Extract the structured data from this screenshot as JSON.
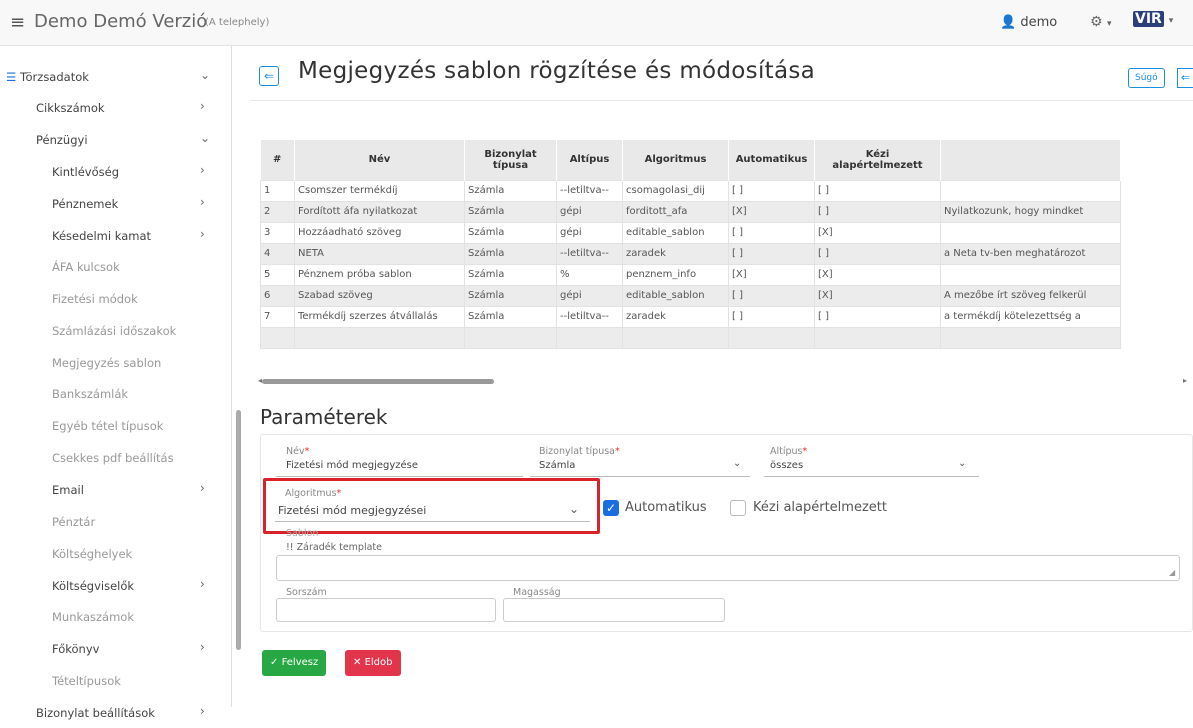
{
  "header": {
    "menu_icon": "menu-icon",
    "app_title": "Demo Demó Verzió",
    "app_sub": "(A telephely)",
    "user_icon": "user-icon",
    "user_name": "demo",
    "settings_icon": "gear-icon",
    "logo_text": "VIR"
  },
  "sidebar": {
    "items": [
      {
        "label": "Törzsadatok",
        "chevron": "⌄"
      },
      {
        "label": "Cikkszámok",
        "chevron": "›"
      },
      {
        "label": "Pénzügyi",
        "chevron": "⌄"
      },
      {
        "label": "Kintlévőség",
        "chevron": "›"
      },
      {
        "label": "Pénznemek",
        "chevron": "›"
      },
      {
        "label": "Késedelmi kamat",
        "chevron": "›"
      },
      {
        "label": "ÁFA kulcsok",
        "chevron": ""
      },
      {
        "label": "Fizetési módok",
        "chevron": ""
      },
      {
        "label": "Számlázási időszakok",
        "chevron": ""
      },
      {
        "label": "Megjegyzés sablon",
        "chevron": ""
      },
      {
        "label": "Bankszámlák",
        "chevron": ""
      },
      {
        "label": "Egyéb tétel típusok",
        "chevron": ""
      },
      {
        "label": "Csekkes pdf beállítás",
        "chevron": ""
      },
      {
        "label": "Email",
        "chevron": "›"
      },
      {
        "label": "Pénztár",
        "chevron": ""
      },
      {
        "label": "Költséghelyek",
        "chevron": ""
      },
      {
        "label": "Költségviselők",
        "chevron": "›"
      },
      {
        "label": "Munkaszámok",
        "chevron": ""
      },
      {
        "label": "Főkönyv",
        "chevron": "›"
      },
      {
        "label": "Tételtípusok",
        "chevron": ""
      },
      {
        "label": "Bizonylat beállítások",
        "chevron": "›"
      }
    ]
  },
  "page": {
    "back_icon": "arrow-left-icon",
    "title": "Megjegyzés sablon rögzítése és módosítása",
    "help_label": "Súgó"
  },
  "table": {
    "columns": [
      "#",
      "Név",
      "Bizonylat típusa",
      "Altípus",
      "Algoritmus",
      "Automatikus",
      "Kézi alapértelmezett",
      ""
    ],
    "rows": [
      [
        "1",
        "Csomszer termékdíj",
        "Számla",
        "--letiltva--",
        "csomagolasi_dij",
        "[ ]",
        "[ ]",
        ""
      ],
      [
        "2",
        "Fordított áfa nyilatkozat",
        "Számla",
        "gépi",
        "forditott_afa",
        "[X]",
        "[ ]",
        "Nyilatkozunk, hogy mindket"
      ],
      [
        "3",
        "Hozzáadható szöveg",
        "Számla",
        "gépi",
        "editable_sablon",
        "[ ]",
        "[X]",
        ""
      ],
      [
        "4",
        "NETA",
        "Számla",
        "--letiltva--",
        "zaradek",
        "[ ]",
        "[ ]",
        "a Neta tv-ben meghatározot"
      ],
      [
        "5",
        "Pénznem próba sablon",
        "Számla",
        "%",
        "penznem_info",
        "[X]",
        "[X]",
        ""
      ],
      [
        "6",
        "Szabad szöveg",
        "Számla",
        "gépi",
        "editable_sablon",
        "[ ]",
        "[X]",
        "A mezőbe írt szöveg felkerül"
      ],
      [
        "7",
        "Termékdíj szerzes átvállalás",
        "Számla",
        "--letiltva--",
        "zaradek",
        "[ ]",
        "[ ]",
        "a termékdíj kötelezettség a"
      ],
      [
        "",
        "",
        "",
        "",
        "",
        "",
        "",
        ""
      ]
    ]
  },
  "form": {
    "section_title": "Paraméterek",
    "nev_label": "Név",
    "nev_value": "Fizetési mód megjegyzése",
    "bizonylat_label": "Bizonylat típusa",
    "bizonylat_value": "Számla",
    "altipus_label": "Altípus",
    "altipus_value": "összes",
    "algoritmus_label": "Algoritmus",
    "algoritmus_value": "Fizetési mód megjegyzései",
    "automatikus_label": "Automatikus",
    "automatikus_checked": true,
    "kezi_label": "Kézi alapértelmezett",
    "kezi_checked": false,
    "sablon_label": "Sablon",
    "sablon_value": "!! Záradék template",
    "sorszam_label": "Sorszám",
    "magassag_label": "Magasság",
    "required_mark": "*"
  },
  "buttons": {
    "save_label": "Felvesz",
    "save_icon": "check-icon",
    "cancel_label": "Eldob",
    "cancel_icon": "close-icon"
  },
  "colors": {
    "accent": "#1a8ee0",
    "save": "#27a845",
    "cancel": "#e2344b",
    "highlight": "#d9232b"
  }
}
